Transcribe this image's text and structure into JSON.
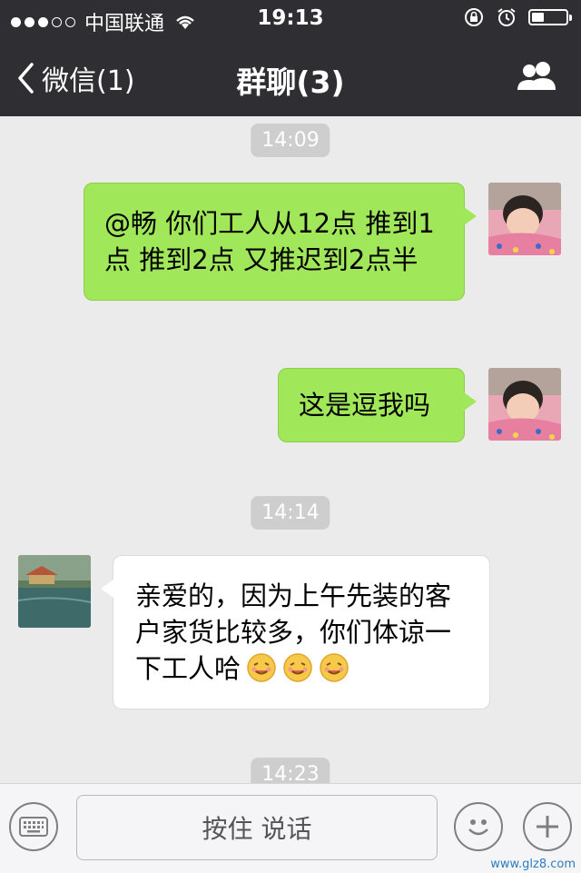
{
  "status_bar": {
    "carrier": "中国联通",
    "time": "19:13",
    "battery_level": 0.35
  },
  "nav": {
    "back_label": "微信(1)",
    "title": "群聊(3)",
    "right_icon": "group-members-icon"
  },
  "messages": [
    {
      "type": "timestamp",
      "text": "14:09"
    },
    {
      "type": "outgoing",
      "text": "@畅 你们工人从12点 推到1点 推到2点 又推迟到2点半"
    },
    {
      "type": "outgoing",
      "text": "这是逗我吗"
    },
    {
      "type": "timestamp",
      "text": "14:14"
    },
    {
      "type": "incoming",
      "text": "亲爱的，因为上午先装的客户家货比较多，你们体谅一下工人哈",
      "emojis": [
        "smile-emoji",
        "smile-emoji",
        "smile-emoji"
      ]
    },
    {
      "type": "timestamp",
      "text": "14:23"
    }
  ],
  "input_bar": {
    "hold_to_talk": "按住 说话",
    "left_icon": "keyboard-icon",
    "emoji_icon": "emoji-icon",
    "plus_icon": "plus-icon"
  },
  "watermark": "www.glz8.com"
}
